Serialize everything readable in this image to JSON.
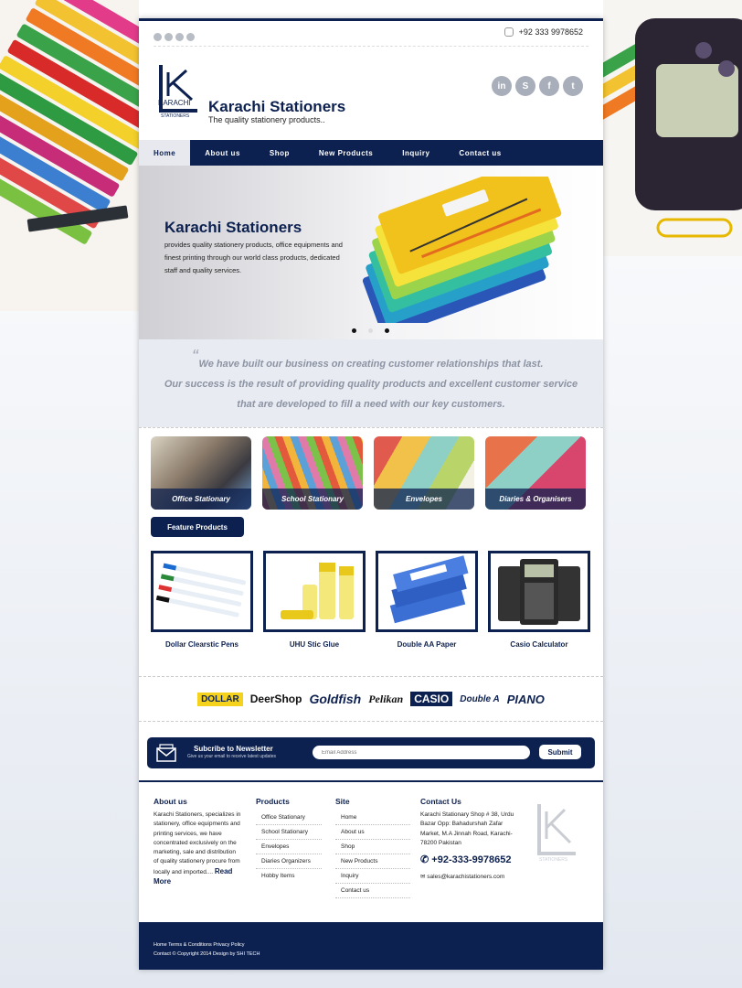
{
  "topbar": {
    "social_icons": [
      "twitter-icon",
      "facebook-icon",
      "skype-icon",
      "linkedin-icon"
    ],
    "phone": "+92 333 9978652"
  },
  "header": {
    "logo_text": "KARACHI",
    "logo_sub": "STATIONERS",
    "brand_name": "Karachi Stationers",
    "tagline": "The quality stationery products..",
    "social_icons": [
      "linkedin-icon",
      "skype-icon",
      "facebook-icon",
      "twitter-icon"
    ]
  },
  "nav": {
    "items": [
      {
        "label": "Home",
        "active": true
      },
      {
        "label": "About us"
      },
      {
        "label": "Shop"
      },
      {
        "label": "New Products"
      },
      {
        "label": "Inquiry"
      },
      {
        "label": "Contact us"
      }
    ]
  },
  "hero": {
    "title": "Karachi Stationers",
    "text": "provides quality stationery products, office equipments and finest printing through our world class products, dedicated staff and quality services.",
    "slides": 3,
    "active_slide": 1
  },
  "quote": {
    "line1": "We have built our business on creating customer relationships that last.",
    "line2": "Our success is the result of providing quality products and excellent customer service",
    "line3": "that are developed to fill a need with our key customers."
  },
  "categories": [
    {
      "label": "Office Stationary"
    },
    {
      "label": "School Stationary"
    },
    {
      "label": "Envelopes"
    },
    {
      "label": "Diaries & Organisers"
    }
  ],
  "feature": {
    "button_label": "Feature Products",
    "products": [
      {
        "name": "Dollar Clearstic Pens"
      },
      {
        "name": "UHU Stic Glue"
      },
      {
        "name": "Double AA Paper"
      },
      {
        "name": "Casio Calculator"
      }
    ]
  },
  "brands": [
    "DOLLAR",
    "DeerShop",
    "Goldfish",
    "Pelikan",
    "CASIO",
    "Double A",
    "PIANO"
  ],
  "newsletter": {
    "title": "Subcribe to Newsletter",
    "subtitle": "Give us your email to receive latest updates",
    "placeholder": "Email Address",
    "submit_label": "Submit"
  },
  "footer": {
    "about": {
      "heading": "About us",
      "text": "Karachi Stationers, specializes in stationery, office equipments and printing services, we have concentrated exclusively on the marketing, sale and distribution of quality stationery procure from locally and imported....",
      "read_more": "Read More"
    },
    "products": {
      "heading": "Products",
      "items": [
        "Office Stationary",
        "School Stationary",
        "Envelopes",
        "Diaries Organizers",
        "Hobby Items"
      ]
    },
    "site": {
      "heading": "Site",
      "items": [
        "Home",
        "About us",
        "Shop",
        "New Products",
        "Inquiry",
        "Contact us"
      ]
    },
    "contact": {
      "heading": "Contact Us",
      "address": "Karachi Stationary Shop # 38, Urdu Bazar Opp: Bahadurshah Zafar Market, M.A Jinnah Road, Karachi-78200 Pakistan",
      "phone": "+92-333-9978652",
      "email": "sales@karachistationers.com"
    },
    "bottom_links": "Home Terms & Conditions Privacy Policy",
    "copyright": "Contact © Copyright 2014 Design by SHI TECH"
  },
  "colors": {
    "navy": "#0d2150",
    "quote_bg": "#e8ebf1",
    "quote_text": "#8c93a3"
  }
}
